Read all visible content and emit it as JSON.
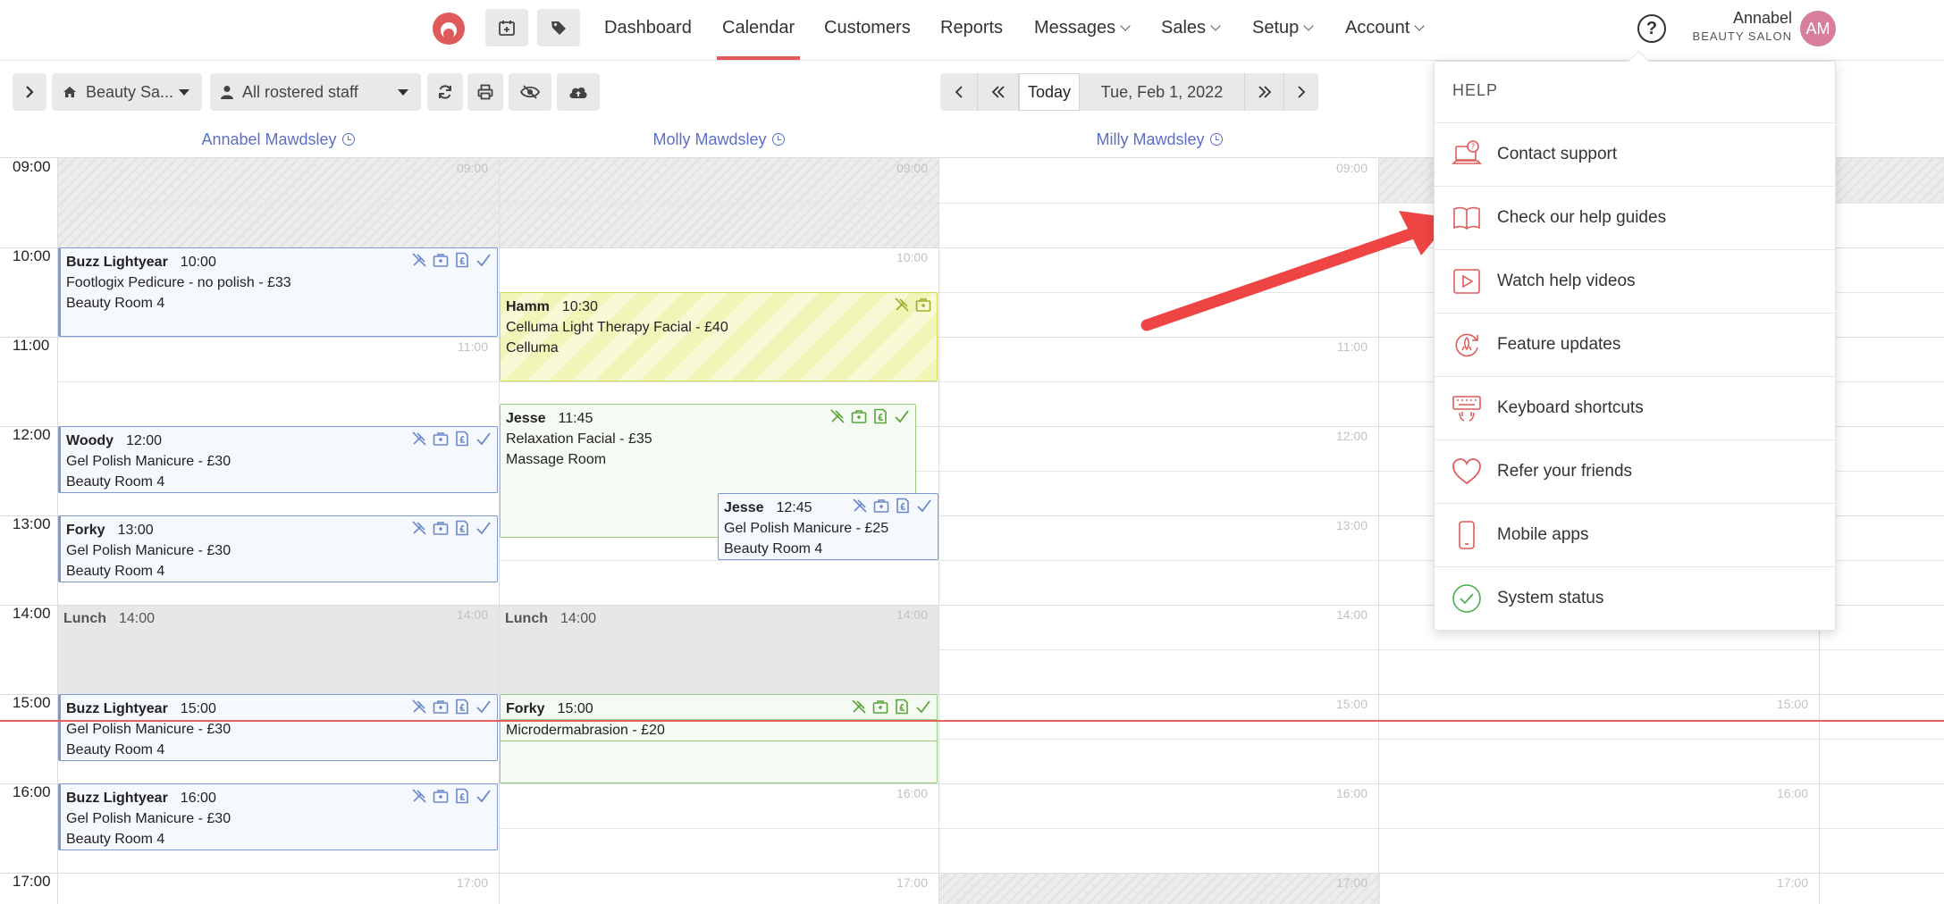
{
  "nav": {
    "links": [
      {
        "label": "Dashboard",
        "dropdown": false,
        "active": false
      },
      {
        "label": "Calendar",
        "dropdown": false,
        "active": true
      },
      {
        "label": "Customers",
        "dropdown": false,
        "active": false
      },
      {
        "label": "Reports",
        "dropdown": false,
        "active": false
      },
      {
        "label": "Messages",
        "dropdown": true,
        "active": false
      },
      {
        "label": "Sales",
        "dropdown": true,
        "active": false
      },
      {
        "label": "Setup",
        "dropdown": true,
        "active": false
      },
      {
        "label": "Account",
        "dropdown": true,
        "active": false
      }
    ],
    "help_glyph": "?",
    "user_name": "Annabel",
    "user_salon": "BEAUTY SALON",
    "avatar_initials": "AM",
    "accent_color": "#e05a5a",
    "avatar_color": "#d77e9f"
  },
  "toolbar": {
    "location": "Beauty Sa...",
    "staff_filter": "All rostered staff",
    "today_label": "Today",
    "date_label": "Tue, Feb 1, 2022"
  },
  "calendar": {
    "columns": [
      "Annabel Mawdsley",
      "Molly Mawdsley",
      "Milly Mawdsley"
    ],
    "hours": [
      "09:00",
      "10:00",
      "11:00",
      "12:00",
      "13:00",
      "14:00",
      "15:00",
      "16:00",
      "17:00"
    ],
    "appointments": [
      {
        "customer": "Buzz Lightyear",
        "time": "10:00",
        "service": "Footlogix Pedicure - no polish - £33",
        "room": "Beauty Room 4"
      },
      {
        "customer": "Hamm",
        "time": "10:30",
        "service": "Celluma Light Therapy Facial - £40",
        "room": "Celluma"
      },
      {
        "customer": "Jesse",
        "time": "11:45",
        "service": "Relaxation Facial - £35",
        "room": "Massage Room"
      },
      {
        "customer": "Woody",
        "time": "12:00",
        "service": "Gel Polish Manicure - £30",
        "room": "Beauty Room 4"
      },
      {
        "customer": "Jesse",
        "time": "12:45",
        "service": "Gel Polish Manicure - £25",
        "room": "Beauty Room 4"
      },
      {
        "customer": "Forky",
        "time": "13:00",
        "service": "Gel Polish Manicure - £30",
        "room": "Beauty Room 4"
      },
      {
        "customer": "Lunch",
        "time": "14:00",
        "service": "",
        "room": ""
      },
      {
        "customer": "Lunch",
        "time": "14:00",
        "service": "",
        "room": ""
      },
      {
        "customer": "Buzz Lightyear",
        "time": "15:00",
        "service": "Gel Polish Manicure - £30",
        "room": "Beauty Room 4"
      },
      {
        "customer": "Forky",
        "time": "15:00",
        "service": "Microdermabrasion - £20",
        "room": ""
      },
      {
        "customer": "Buzz Lightyear",
        "time": "16:00",
        "service": "Gel Polish Manicure - £30",
        "room": "Beauty Room 4"
      }
    ]
  },
  "help_menu": {
    "title": "HELP",
    "items": [
      {
        "label": "Contact support",
        "icon": "support-laptop-icon"
      },
      {
        "label": "Check our help guides",
        "icon": "book-icon"
      },
      {
        "label": "Watch help videos",
        "icon": "video-play-icon"
      },
      {
        "label": "Feature updates",
        "icon": "rocket-refresh-icon"
      },
      {
        "label": "Keyboard shortcuts",
        "icon": "keyboard-icon"
      },
      {
        "label": "Refer your friends",
        "icon": "heart-icon"
      },
      {
        "label": "Mobile apps",
        "icon": "mobile-phone-icon"
      },
      {
        "label": "System status",
        "icon": "check-circle-icon"
      }
    ],
    "icon_color": "#e05a5a",
    "status_color": "#4caf50"
  }
}
